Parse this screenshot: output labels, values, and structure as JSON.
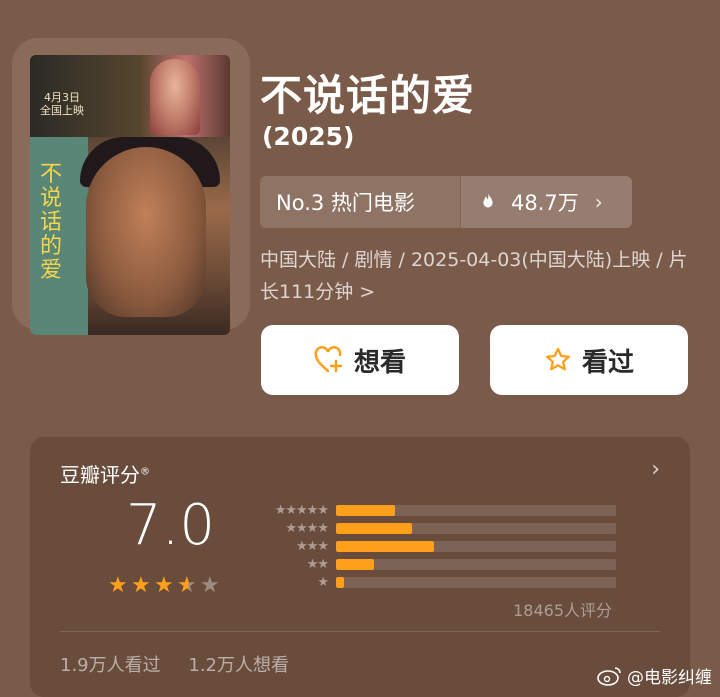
{
  "movie": {
    "title": "不说话的爱",
    "year": "(2025)",
    "poster": {
      "date": "4月3日\n全国上映",
      "title": "不说话的爱"
    },
    "rank_label": "No.3 热门电影",
    "heat": "48.7万",
    "meta": "中国大陆 / 剧情 / 2025-04-03(中国大陆)上映 / 片长111分钟 >"
  },
  "actions": {
    "want": "想看",
    "seen": "看过"
  },
  "rating": {
    "label": "豆瓣评分",
    "score": "7.0",
    "stars_filled": 3.5,
    "stars_total": 5,
    "distribution": [
      {
        "stars": "★★★★★",
        "fraction": 0.21
      },
      {
        "stars": "★★★★",
        "fraction": 0.27
      },
      {
        "stars": "★★★",
        "fraction": 0.35
      },
      {
        "stars": "★★",
        "fraction": 0.135
      },
      {
        "stars": "★",
        "fraction": 0.03
      }
    ],
    "raters": "18465人评分",
    "seen_count": "1.9万人看过",
    "want_count": "1.2万人想看"
  },
  "watermark": "@电影纠缠",
  "colors": {
    "background": "#7a5a48",
    "accent": "#ff9f1a"
  }
}
